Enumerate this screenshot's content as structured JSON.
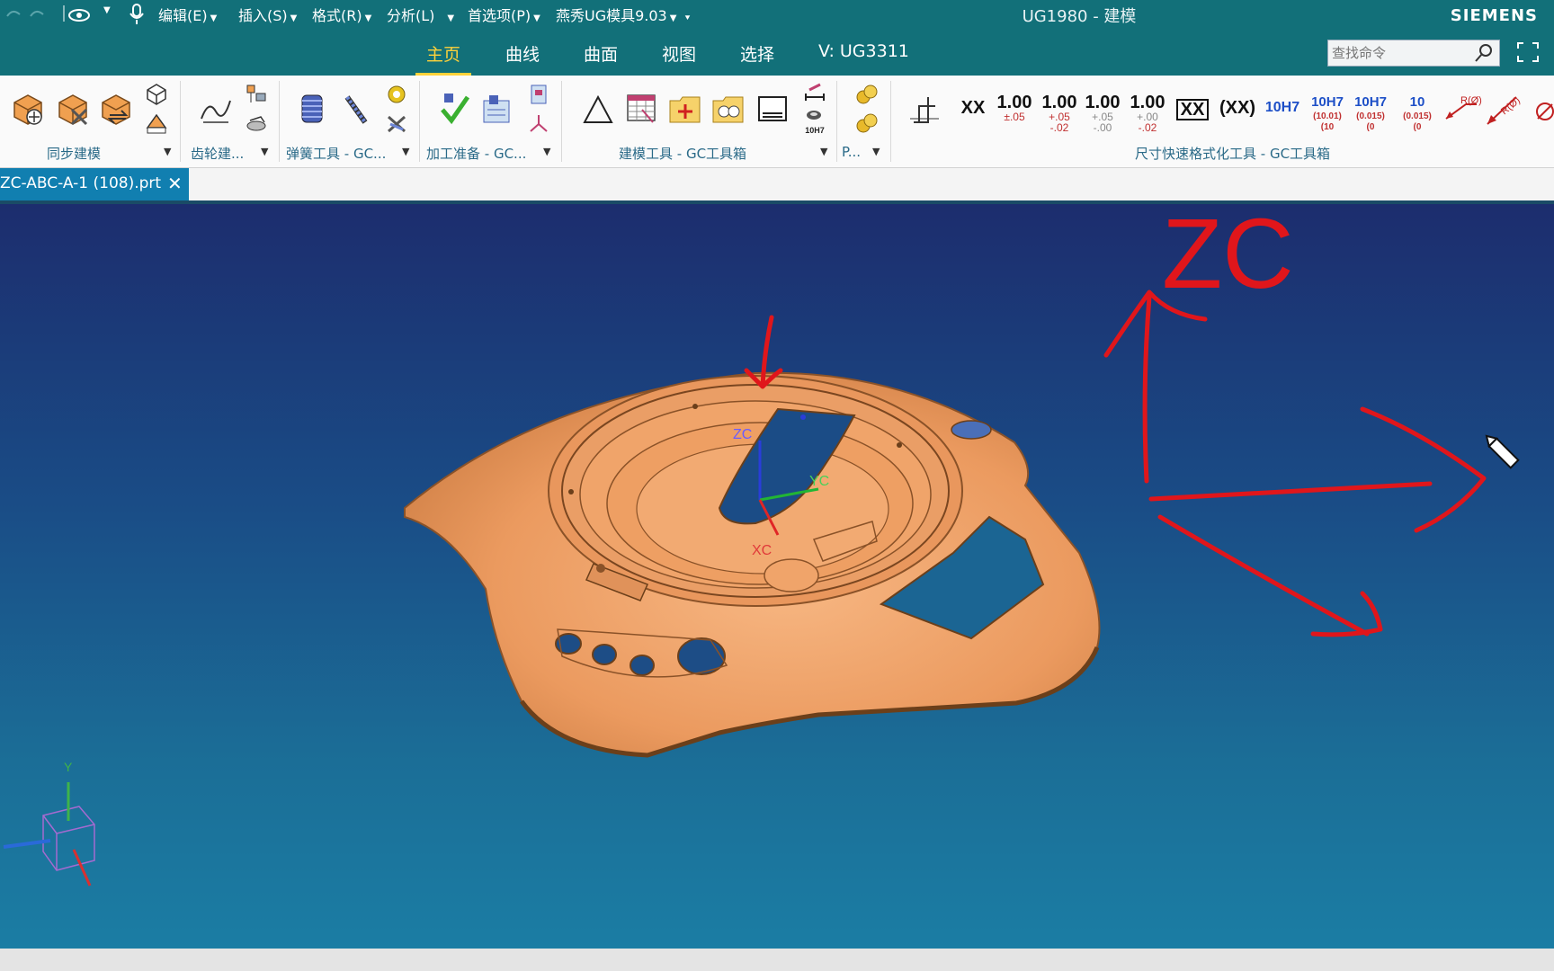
{
  "title_bar": {
    "menus": [
      {
        "label": "编辑(E)"
      },
      {
        "label": "插入(S)"
      },
      {
        "label": "格式(R)"
      },
      {
        "label": "分析(L)"
      },
      {
        "label": "首选项(P)"
      },
      {
        "label": "燕秀UG模具9.03"
      }
    ],
    "app_title": "UG1980 - 建模",
    "brand": "SIEMENS"
  },
  "tabs": [
    {
      "label": "主页",
      "active": true
    },
    {
      "label": "曲线"
    },
    {
      "label": "曲面"
    },
    {
      "label": "视图"
    },
    {
      "label": "选择"
    },
    {
      "label": "V:  UG3311"
    }
  ],
  "search": {
    "placeholder": "查找命令"
  },
  "ribbon": {
    "groups": [
      {
        "label": "同步建模"
      },
      {
        "label": "齿轮建..."
      },
      {
        "label": "弹簧工具 - GC..."
      },
      {
        "label": "加工准备 - GC..."
      },
      {
        "label": "建模工具 - GC工具箱"
      },
      {
        "label": "P..."
      },
      {
        "label": "尺寸快速格式化工具 - GC工具箱"
      }
    ],
    "dimension_buttons": {
      "xx": "XX",
      "d1": {
        "value": "1.00",
        "tol": "±.05"
      },
      "d2": {
        "value": "1.00",
        "tol_top": "+.05",
        "tol_bottom": "-.02"
      },
      "d3": {
        "value": "1.00",
        "tol_top": "+.05",
        "tol_bottom": "-.00"
      },
      "d4": {
        "value": "1.00",
        "tol_top": "+.00",
        "tol_bottom": "-.02"
      },
      "boxed": "XX",
      "paren": "(XX)",
      "h7": "10H7",
      "h7a": {
        "value": "10H7",
        "sub1": "(10.01)",
        "sub2": "(10"
      },
      "h7b": {
        "value": "10H7",
        "sub1": "(0.015)",
        "sub2": "(0"
      },
      "ten": {
        "value": "10",
        "sub1": "(0.015)",
        "sub2": "(0"
      },
      "r1": "R(Ø)",
      "r2": "R(Ø)",
      "small_10h7": "10H7"
    }
  },
  "document_tab": {
    "name": "ZC-ABC-A-1 (108).prt",
    "close": "✕"
  },
  "viewport": {
    "csys": {
      "zc": "ZC",
      "yc": "YC",
      "xc": "XC"
    },
    "view_triad": {
      "y": "Y"
    },
    "annotation": {
      "text": "ZC",
      "color": "#e0161b"
    }
  },
  "colors": {
    "titlebar": "#127079",
    "active_tab": "#ffd23a",
    "part": "#e9975d",
    "annotation": "#e0161b"
  }
}
